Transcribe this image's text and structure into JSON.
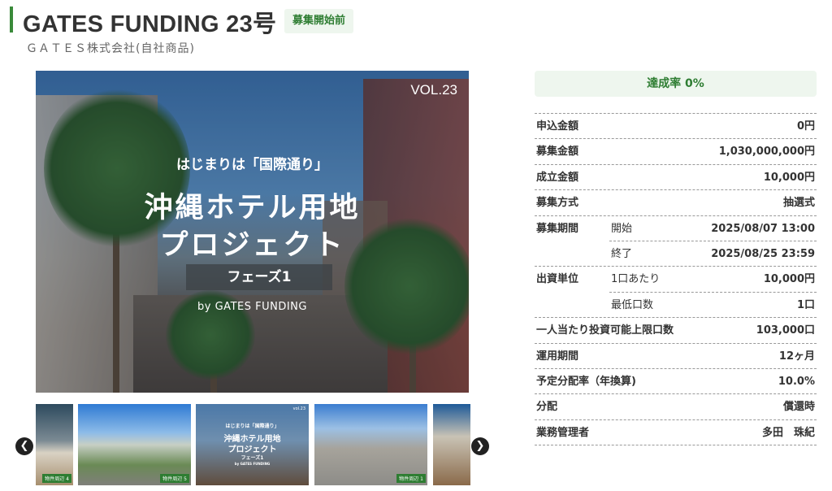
{
  "header": {
    "title": "GATES FUNDING 23号",
    "status": "募集開始前",
    "company": "ＧＡＴＥＳ株式会社(自社商品)"
  },
  "main_image": {
    "vol": "VOL.23",
    "subtitle": "はじまりは「国際通り」",
    "headline_1": "沖縄ホテル用地",
    "headline_2": "プロジェクト",
    "phase": "フェーズ1",
    "byline": "by GATES FUNDING"
  },
  "thumbnails": {
    "tag_1": "物件周辺 4",
    "tag_2": "物件周辺 5",
    "tag_4": "物件周辺 1",
    "t3_vol": "vol.23",
    "t3_subtitle": "はじまりは「国際通り」",
    "t3_headline_1": "沖縄ホテル用地",
    "t3_headline_2": "プロジェクト",
    "t3_phase": "フェーズ1",
    "t3_byline": "by GATES FUNDING",
    "prev_icon": "chevron-left-icon",
    "next_icon": "chevron-right-icon"
  },
  "summary": {
    "achievement_rate": "達成率 0%"
  },
  "details": {
    "application_amount_label": "申込金額",
    "application_amount": "0円",
    "recruit_amount_label": "募集金額",
    "recruit_amount": "1,030,000,000円",
    "established_amount_label": "成立金額",
    "established_amount": "10,000円",
    "method_label": "募集方式",
    "method": "抽選式",
    "period_label": "募集期間",
    "period_start_label": "開始",
    "period_start": "2025/08/07 13:00",
    "period_end_label": "終了",
    "period_end": "2025/08/25 23:59",
    "unit_label": "出資単位",
    "unit_per_label": "1口あたり",
    "unit_per": "10,000円",
    "min_units_label": "最低口数",
    "min_units": "1口",
    "max_units_label": "一人当たり投資可能上限口数",
    "max_units": "103,000口",
    "duration_label": "運用期間",
    "duration": "12ヶ月",
    "yield_label": "予定分配率（年換算)",
    "yield": "10.0%",
    "distribution_label": "分配",
    "distribution": "償還時",
    "manager_label": "業務管理者",
    "manager": "多田　珠紀"
  },
  "colors": {
    "accent_green": "#2e7d32",
    "badge_bg": "#eef6ee"
  }
}
